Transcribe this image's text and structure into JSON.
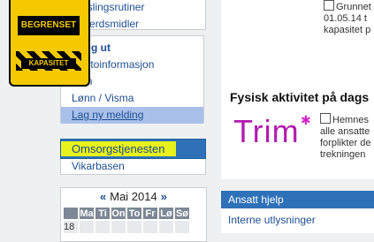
{
  "menu_top": [
    "Varslingsrutiner",
    "Velferdsmidler"
  ],
  "menu_user": [
    {
      "label": "Logg ut",
      "style": "bold"
    },
    {
      "label": "Kontoinformasjon",
      "style": "normal"
    },
    {
      "label": "Trim",
      "style": "normal"
    },
    {
      "label": "Lønn / Visma",
      "style": "normal"
    },
    {
      "label": "Lag ny melding",
      "style": "active"
    }
  ],
  "omsorg": {
    "title": "Omsorgstjenesten",
    "item": "Vikarbasen"
  },
  "calendar": {
    "prev": "«",
    "month": "Mai 2014",
    "next": "»",
    "weekdays": [
      "",
      "Ma",
      "Ti",
      "On",
      "To",
      "Fr",
      "Lø",
      "Sø"
    ],
    "first_week": "18"
  },
  "news": {
    "poster_line1": "BEGRENSET",
    "poster_line2": "KAPASITET",
    "side_text": "Grunnet 01.05.14 t kapasitet p",
    "heading": "Fysisk aktivitet på dags",
    "trim_logo": "Trim",
    "trim_text": "Hemnes alle ansatte forplikter de trekningen"
  },
  "ansatt": {
    "title": "Ansatt hjelp",
    "item": "Interne utlysninger"
  }
}
